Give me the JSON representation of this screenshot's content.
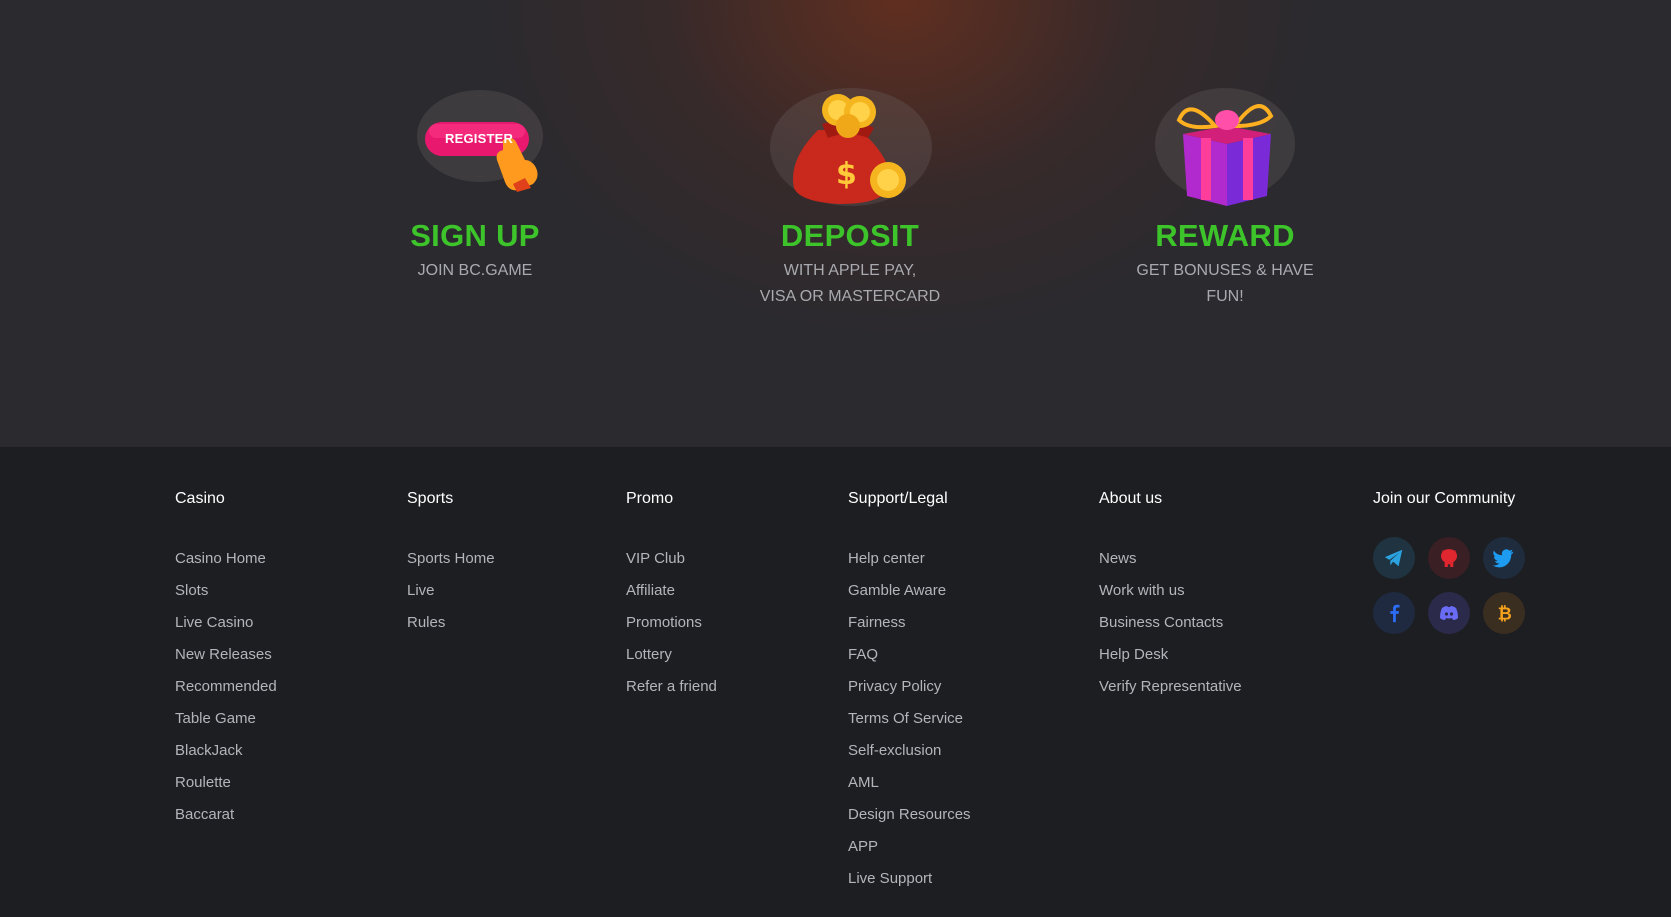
{
  "steps": [
    {
      "title": "SIGN UP",
      "subtitle": "JOIN BC.GAME",
      "illus_text": "REGISTER",
      "icon": "register-hand-icon"
    },
    {
      "title": "DEPOSIT",
      "subtitle": "WITH APPLE PAY,\nVISA OR MASTERCARD",
      "icon": "money-bag-icon"
    },
    {
      "title": "REWARD",
      "subtitle": "GET BONUSES & HAVE\nFUN!",
      "icon": "gift-box-icon"
    }
  ],
  "footer": {
    "casino": {
      "title": "Casino",
      "items": [
        "Casino Home",
        "Slots",
        "Live Casino",
        "New Releases",
        "Recommended",
        "Table Game",
        "BlackJack",
        "Roulette",
        "Baccarat"
      ]
    },
    "sports": {
      "title": "Sports",
      "items": [
        "Sports Home",
        "Live",
        "Rules"
      ]
    },
    "promo": {
      "title": "Promo",
      "items": [
        "VIP Club",
        "Affiliate",
        "Promotions",
        "Lottery",
        "Refer a friend"
      ]
    },
    "support": {
      "title": "Support/Legal",
      "items": [
        "Help center",
        "Gamble Aware",
        "Fairness",
        "FAQ",
        "Privacy Policy",
        "Terms Of Service",
        "Self-exclusion",
        "AML",
        "Design Resources",
        "APP",
        "Live Support"
      ]
    },
    "about": {
      "title": "About us",
      "items": [
        "News",
        "Work with us",
        "Business Contacts",
        "Help Desk",
        "Verify Representative"
      ]
    },
    "community": {
      "title": "Join our Community",
      "icons": [
        "telegram-icon",
        "github-icon",
        "twitter-icon",
        "facebook-icon",
        "discord-icon",
        "bitcoin-icon"
      ]
    }
  },
  "colors": {
    "accent_green": "#3dc42b",
    "background": "#1c1e22",
    "hero_bg": "#2b2a2e"
  }
}
